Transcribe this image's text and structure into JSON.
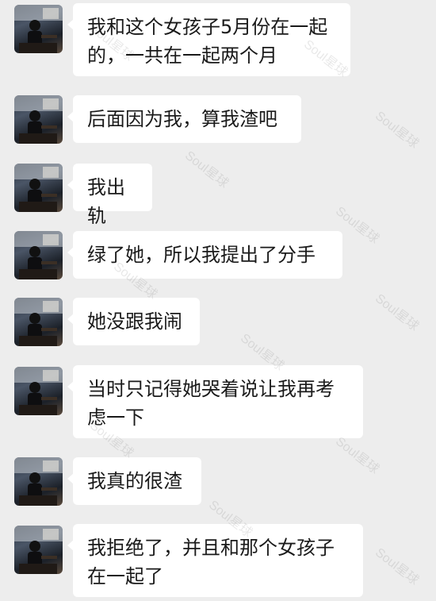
{
  "watermark": "Soul星球",
  "messages": [
    {
      "text_lines": [
        "我和这个女孩子5月份在一起",
        "的，一共在一起两个月"
      ]
    },
    {
      "text_lines": [
        "后面因为我，算我渣吧"
      ]
    },
    {
      "text_lines": [
        "我出轨"
      ]
    },
    {
      "text_lines": [
        "绿了她，所以我提出了分手"
      ]
    },
    {
      "text_lines": [
        "她没跟我闹"
      ]
    },
    {
      "text_lines": [
        "当时只记得她哭着说让我再考",
        "虑一下"
      ]
    },
    {
      "text_lines": [
        "我真的很渣"
      ]
    },
    {
      "text_lines": [
        "我拒绝了，并且和那个女孩子",
        "在一起了"
      ]
    }
  ]
}
